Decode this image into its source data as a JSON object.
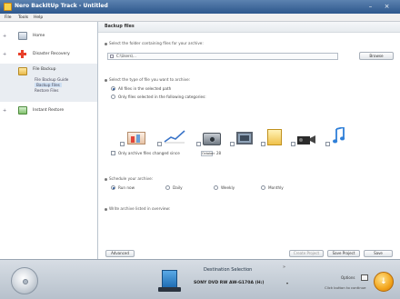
{
  "window": {
    "title": "Nero BackItUp Track - Untitled",
    "min_glyph": "–",
    "close_glyph": "×"
  },
  "menu": [
    "File",
    "Tools",
    "Help"
  ],
  "sidebar": {
    "items": [
      {
        "label": "Home",
        "icon": "home-icon"
      },
      {
        "label": "Disaster Recovery",
        "icon": "plus-icon"
      },
      {
        "label": "File Backup",
        "icon": "folder-icon"
      },
      {
        "label": "Instant Restore",
        "icon": "restore-icon"
      }
    ],
    "sub_items": [
      "File Backup Guide",
      "Backup Files",
      "Restore Files"
    ],
    "expand_glyph": "+"
  },
  "main": {
    "title": "Backup files",
    "step1": "Select the folder containing files for your archive:",
    "path_value": "C:\\Users\\...",
    "browse_label": "Browse",
    "step2": "Select the type of file you want to archive:",
    "radio_all": "All files in the selected path",
    "radio_cat": "Only files selected in the following categories:",
    "modified_label": "Only archive files changed since",
    "modified_select": "October",
    "modified_num": "28",
    "step3": "Schedule your archive:",
    "schedule": [
      "Run now",
      "Daily",
      "Weekly",
      "Monthly"
    ],
    "step4": "Write archive listed in overview:",
    "buttons": {
      "advanced": "Advanced",
      "create_project": "Create Project",
      "save_project": "Save Project",
      "save": "Save"
    }
  },
  "bottom": {
    "dest_title": "Destination Selection",
    "dest_drive": "SONY DVD RW AW-G170A (H:)",
    "dest_arrow": "▾",
    "dest_more": "»",
    "options_label": "Options",
    "options_sub": "Click button to continue",
    "burn_glyph": "↓"
  },
  "colors": {
    "accent": "#2d578c",
    "burn": "#f3a51c"
  }
}
